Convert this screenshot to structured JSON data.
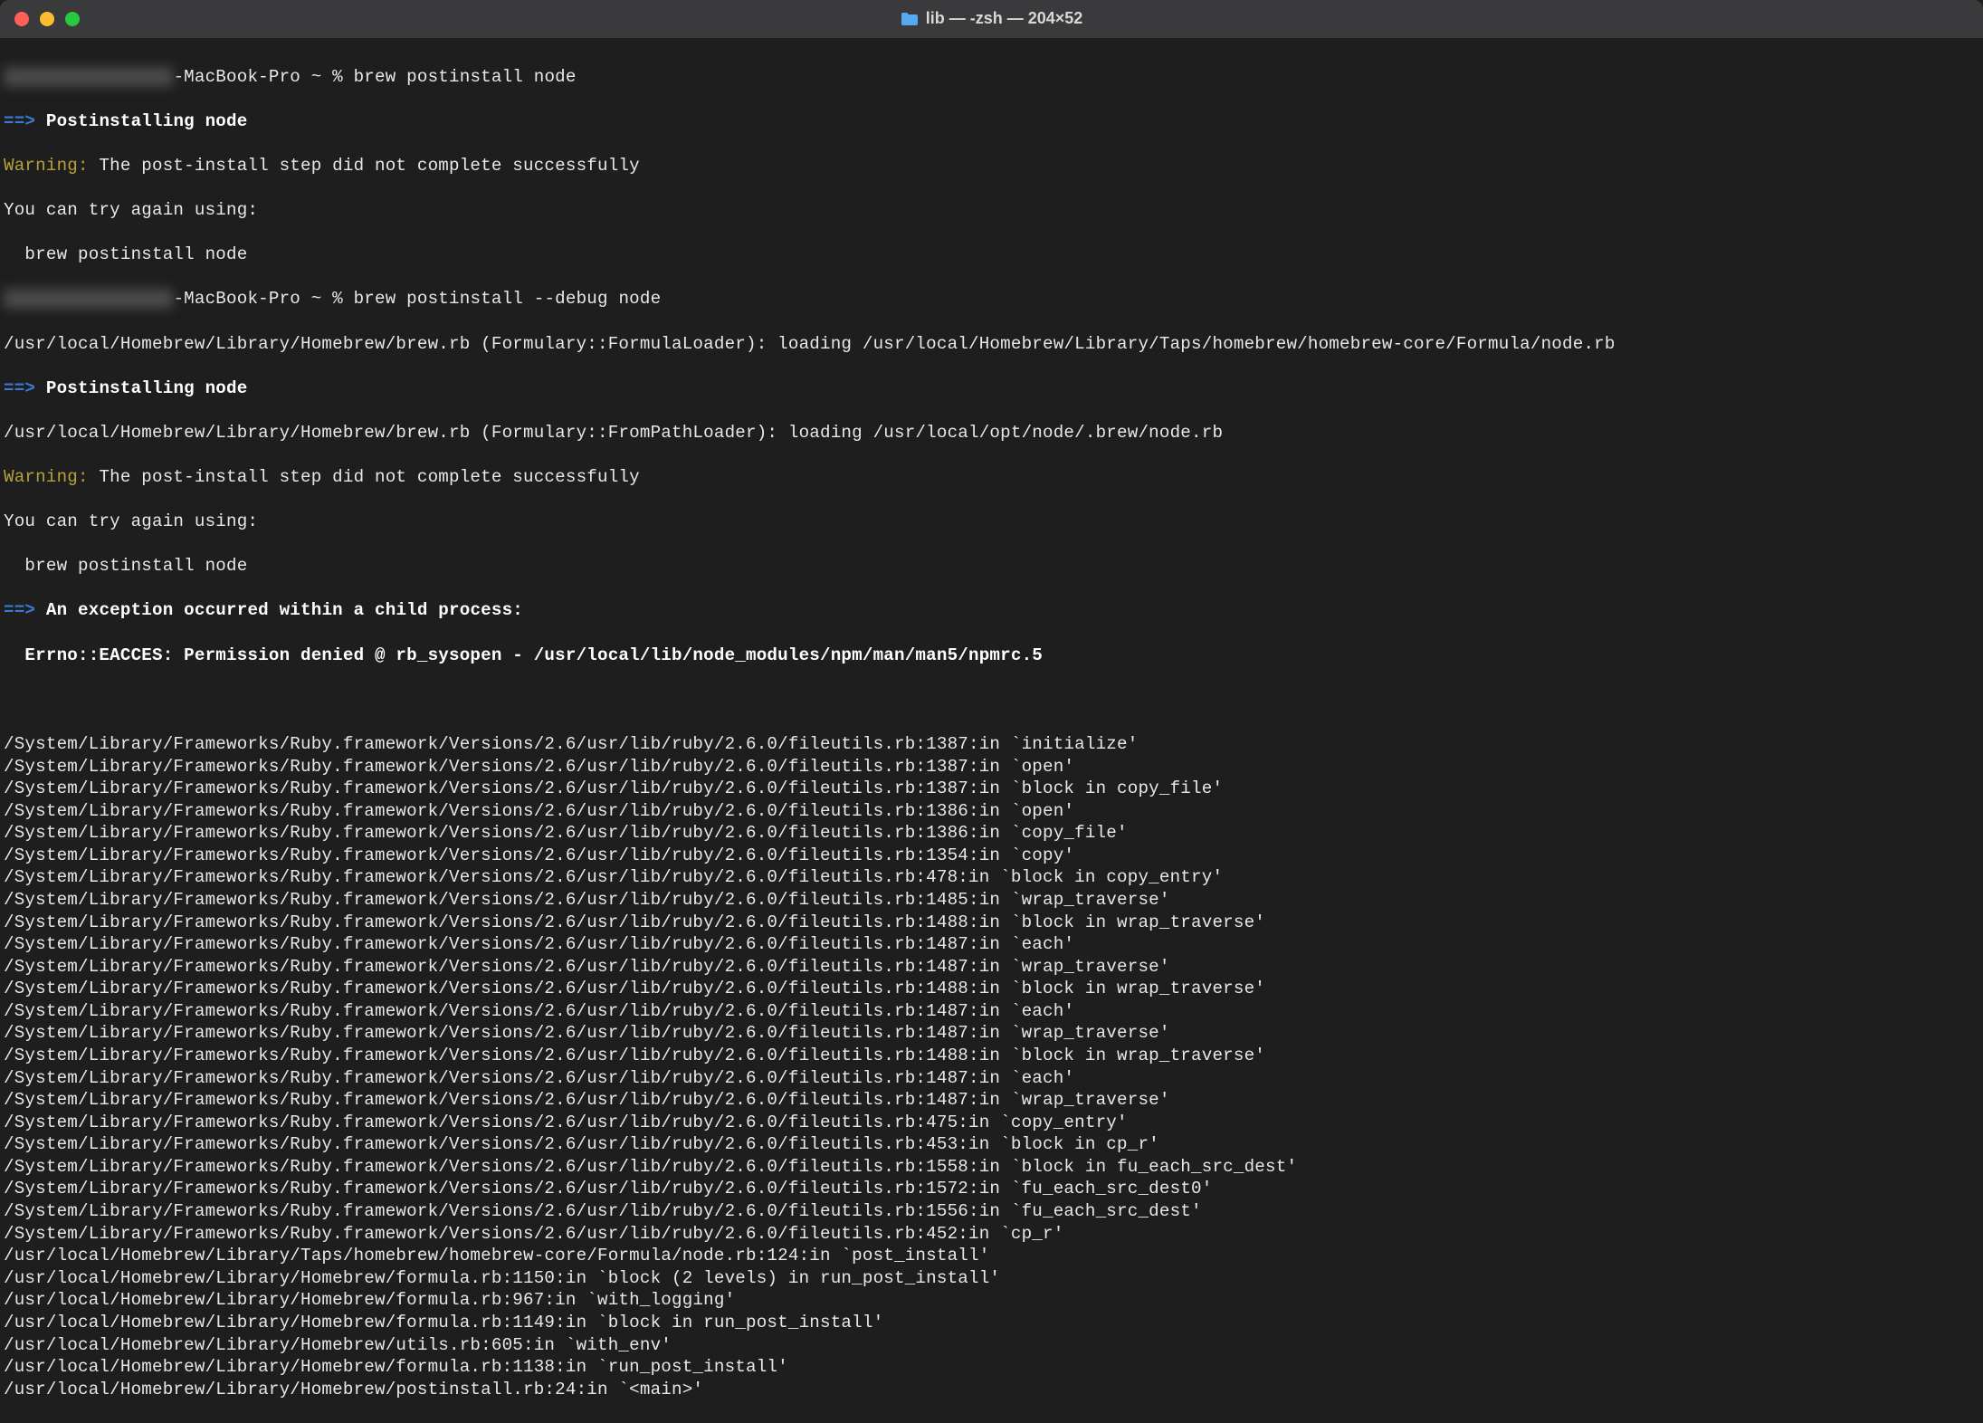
{
  "window": {
    "title": "lib — -zsh — 204×52"
  },
  "blur": {
    "host1": "████████████████",
    "host2": "████████████████"
  },
  "prompt": {
    "p1_host_suffix": "-MacBook-Pro ~ % ",
    "p1_cmd": "brew postinstall node",
    "p2_host_suffix": "-MacBook-Pro ~ % ",
    "p2_cmd": "brew postinstall --debug node"
  },
  "sym": {
    "arrow": "==>"
  },
  "labels": {
    "postinstalling": " Postinstalling node",
    "warning": "Warning:",
    "warn_msg": " The post-install step did not complete successfully",
    "try_again": "You can try again using:",
    "retry_cmd": "  brew postinstall node",
    "exception_header": " An exception occurred within a child process:",
    "exception_body": "  Errno::EACCES: Permission denied @ rb_sysopen - /usr/local/lib/node_modules/npm/man/man5/npmrc.5"
  },
  "loader": {
    "formula": "/usr/local/Homebrew/Library/Homebrew/brew.rb (Formulary::FormulaLoader): loading /usr/local/Homebrew/Library/Taps/homebrew/homebrew-core/Formula/node.rb",
    "frompath": "/usr/local/Homebrew/Library/Homebrew/brew.rb (Formulary::FromPathLoader): loading /usr/local/opt/node/.brew/node.rb"
  },
  "trace": [
    "/System/Library/Frameworks/Ruby.framework/Versions/2.6/usr/lib/ruby/2.6.0/fileutils.rb:1387:in `initialize'",
    "/System/Library/Frameworks/Ruby.framework/Versions/2.6/usr/lib/ruby/2.6.0/fileutils.rb:1387:in `open'",
    "/System/Library/Frameworks/Ruby.framework/Versions/2.6/usr/lib/ruby/2.6.0/fileutils.rb:1387:in `block in copy_file'",
    "/System/Library/Frameworks/Ruby.framework/Versions/2.6/usr/lib/ruby/2.6.0/fileutils.rb:1386:in `open'",
    "/System/Library/Frameworks/Ruby.framework/Versions/2.6/usr/lib/ruby/2.6.0/fileutils.rb:1386:in `copy_file'",
    "/System/Library/Frameworks/Ruby.framework/Versions/2.6/usr/lib/ruby/2.6.0/fileutils.rb:1354:in `copy'",
    "/System/Library/Frameworks/Ruby.framework/Versions/2.6/usr/lib/ruby/2.6.0/fileutils.rb:478:in `block in copy_entry'",
    "/System/Library/Frameworks/Ruby.framework/Versions/2.6/usr/lib/ruby/2.6.0/fileutils.rb:1485:in `wrap_traverse'",
    "/System/Library/Frameworks/Ruby.framework/Versions/2.6/usr/lib/ruby/2.6.0/fileutils.rb:1488:in `block in wrap_traverse'",
    "/System/Library/Frameworks/Ruby.framework/Versions/2.6/usr/lib/ruby/2.6.0/fileutils.rb:1487:in `each'",
    "/System/Library/Frameworks/Ruby.framework/Versions/2.6/usr/lib/ruby/2.6.0/fileutils.rb:1487:in `wrap_traverse'",
    "/System/Library/Frameworks/Ruby.framework/Versions/2.6/usr/lib/ruby/2.6.0/fileutils.rb:1488:in `block in wrap_traverse'",
    "/System/Library/Frameworks/Ruby.framework/Versions/2.6/usr/lib/ruby/2.6.0/fileutils.rb:1487:in `each'",
    "/System/Library/Frameworks/Ruby.framework/Versions/2.6/usr/lib/ruby/2.6.0/fileutils.rb:1487:in `wrap_traverse'",
    "/System/Library/Frameworks/Ruby.framework/Versions/2.6/usr/lib/ruby/2.6.0/fileutils.rb:1488:in `block in wrap_traverse'",
    "/System/Library/Frameworks/Ruby.framework/Versions/2.6/usr/lib/ruby/2.6.0/fileutils.rb:1487:in `each'",
    "/System/Library/Frameworks/Ruby.framework/Versions/2.6/usr/lib/ruby/2.6.0/fileutils.rb:1487:in `wrap_traverse'",
    "/System/Library/Frameworks/Ruby.framework/Versions/2.6/usr/lib/ruby/2.6.0/fileutils.rb:475:in `copy_entry'",
    "/System/Library/Frameworks/Ruby.framework/Versions/2.6/usr/lib/ruby/2.6.0/fileutils.rb:453:in `block in cp_r'",
    "/System/Library/Frameworks/Ruby.framework/Versions/2.6/usr/lib/ruby/2.6.0/fileutils.rb:1558:in `block in fu_each_src_dest'",
    "/System/Library/Frameworks/Ruby.framework/Versions/2.6/usr/lib/ruby/2.6.0/fileutils.rb:1572:in `fu_each_src_dest0'",
    "/System/Library/Frameworks/Ruby.framework/Versions/2.6/usr/lib/ruby/2.6.0/fileutils.rb:1556:in `fu_each_src_dest'",
    "/System/Library/Frameworks/Ruby.framework/Versions/2.6/usr/lib/ruby/2.6.0/fileutils.rb:452:in `cp_r'",
    "/usr/local/Homebrew/Library/Taps/homebrew/homebrew-core/Formula/node.rb:124:in `post_install'",
    "/usr/local/Homebrew/Library/Homebrew/formula.rb:1150:in `block (2 levels) in run_post_install'",
    "/usr/local/Homebrew/Library/Homebrew/formula.rb:967:in `with_logging'",
    "/usr/local/Homebrew/Library/Homebrew/formula.rb:1149:in `block in run_post_install'",
    "/usr/local/Homebrew/Library/Homebrew/utils.rb:605:in `with_env'",
    "/usr/local/Homebrew/Library/Homebrew/formula.rb:1138:in `run_post_install'",
    "/usr/local/Homebrew/Library/Homebrew/postinstall.rb:24:in `<main>'"
  ]
}
